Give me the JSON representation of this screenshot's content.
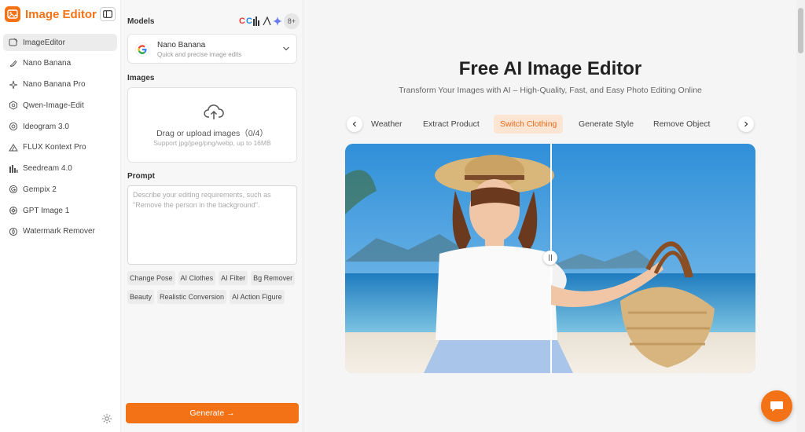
{
  "brand": {
    "name": "Image Editor"
  },
  "sidebar": {
    "items": [
      {
        "label": "ImageEditor",
        "icon": "image-edit-icon",
        "active": true
      },
      {
        "label": "Nano Banana",
        "icon": "banana-icon"
      },
      {
        "label": "Nano Banana Pro",
        "icon": "sparkle-icon"
      },
      {
        "label": "Qwen-Image-Edit",
        "icon": "qwen-icon"
      },
      {
        "label": "Ideogram 3.0",
        "icon": "ideogram-icon"
      },
      {
        "label": "FLUX Kontext Pro",
        "icon": "flux-icon"
      },
      {
        "label": "Seedream 4.0",
        "icon": "seedream-icon"
      },
      {
        "label": "Gempix 2",
        "icon": "gempix-icon"
      },
      {
        "label": "GPT Image 1",
        "icon": "openai-icon"
      },
      {
        "label": "Watermark Remover",
        "icon": "watermark-icon"
      }
    ]
  },
  "panel": {
    "models_label": "Models",
    "models_more": "8+",
    "model": {
      "name": "Nano Banana",
      "description": "Quick and precise image edits"
    },
    "images_label": "Images",
    "upload": {
      "title": "Drag or upload images（0/4）",
      "subtitle": "Support jpg/jpeg/png/webp, up to 16MB"
    },
    "prompt_label": "Prompt",
    "prompt_placeholder": "Describe your editing requirements, such as \"Remove the person in the background\".",
    "chips_row1": [
      "Change Pose",
      "AI Clothes",
      "AI Filter",
      "Bg Remover"
    ],
    "chips_row2": [
      "Beauty",
      "Realistic Conversion",
      "AI Action Figure"
    ],
    "generate_label": "Generate →"
  },
  "main": {
    "title": "Free AI Image Editor",
    "subtitle": "Transform Your Images with AI – High-Quality, Fast, and Easy Photo Editing Online",
    "tabs": [
      "Weather",
      "Extract Product",
      "Switch Clothing",
      "Generate Style",
      "Remove Object"
    ],
    "active_tab": "Switch Clothing"
  },
  "colors": {
    "accent": "#f47216",
    "active_tab_bg": "#fde5d4"
  }
}
